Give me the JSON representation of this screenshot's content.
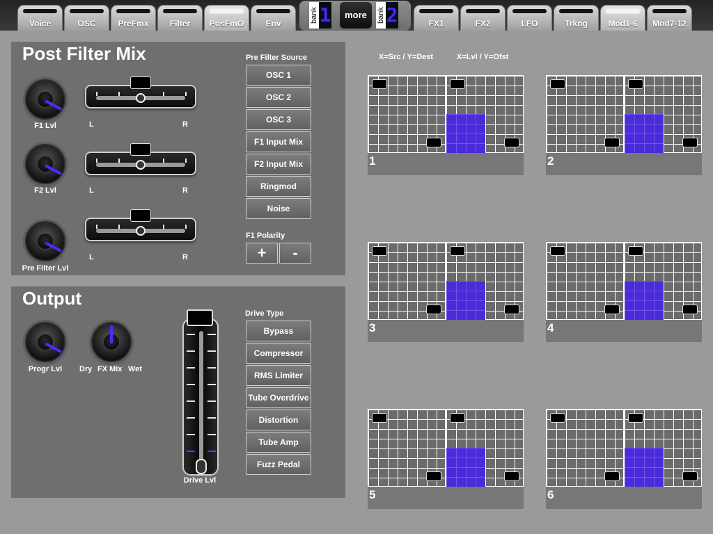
{
  "tabs_left": [
    {
      "label": "Voice"
    },
    {
      "label": "OSC"
    },
    {
      "label": "PreFmx"
    },
    {
      "label": "Filter"
    },
    {
      "label": "PosFmO",
      "active": true
    },
    {
      "label": "Env"
    }
  ],
  "tabs_right": [
    {
      "label": "FX1"
    },
    {
      "label": "FX2"
    },
    {
      "label": "LFO"
    },
    {
      "label": "Trkng"
    },
    {
      "label": "Mod1-6",
      "active": true
    },
    {
      "label": "Mod7-12"
    }
  ],
  "bank_block": {
    "bank_word": "bank",
    "bank_a_digit": "1",
    "more_label": "more",
    "bank_b_digit": "2"
  },
  "post_filter_mix": {
    "title": "Post Filter Mix",
    "channels": [
      {
        "knob_label": "F1 Lvl",
        "left": "L",
        "right": "R"
      },
      {
        "knob_label": "F2 Lvl",
        "left": "L",
        "right": "R"
      },
      {
        "knob_label": "Pre Filter Lvl",
        "left": "L",
        "right": "R"
      }
    ],
    "source_heading": "Pre Filter Source",
    "sources": [
      "OSC 1",
      "OSC 2",
      "OSC 3",
      "F1 Input Mix",
      "F2 Input Mix",
      "Ringmod",
      "Noise"
    ],
    "polarity_heading": "F1 Polarity",
    "polarity_plus": "+",
    "polarity_minus": "-"
  },
  "output": {
    "title": "Output",
    "progr_label": "Progr Lvl",
    "fx_dry": "Dry",
    "fx_label": "FX Mix",
    "fx_wet": "Wet",
    "drive_label": "Drive Lvl",
    "drive_type_heading": "Drive Type",
    "drive_types": [
      "Bypass",
      "Compressor",
      "RMS Limiter",
      "Tube Overdrive",
      "Distortion",
      "Tube Amp",
      "Fuzz Pedal"
    ]
  },
  "mod_matrix": {
    "src_dest_label": "X=Src / Y=Dest",
    "lvl_ofst_label": "X=Lvl / Y=Ofst",
    "pads": [
      {
        "number": "1"
      },
      {
        "number": "2"
      },
      {
        "number": "3"
      },
      {
        "number": "4"
      },
      {
        "number": "5"
      },
      {
        "number": "6"
      }
    ]
  },
  "colors": {
    "accent": "#4b2bd9",
    "panel": "#6f6f6f",
    "background": "#9a9a9a"
  }
}
